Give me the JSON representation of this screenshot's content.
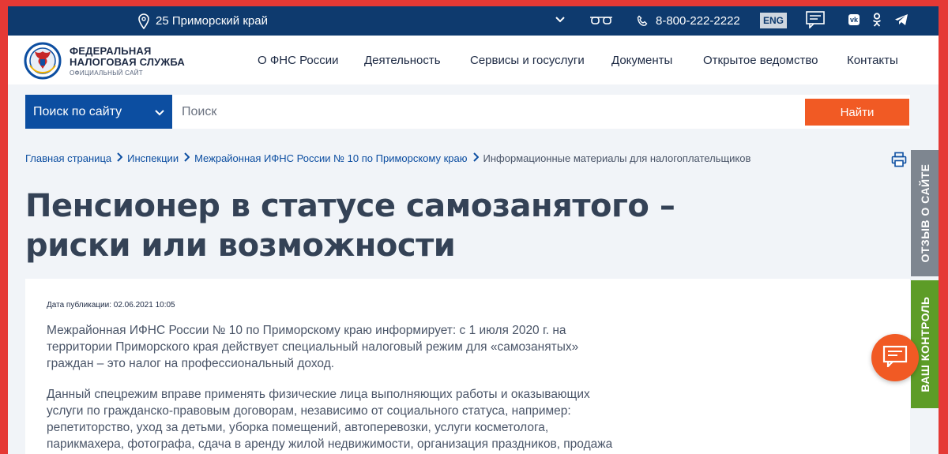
{
  "topbar": {
    "region": "25 Приморский край",
    "phone": "8-800-222-2222",
    "lang": "ENG",
    "vk": "vk"
  },
  "header": {
    "org_line1": "Федеральная",
    "org_line2": "налоговая служба",
    "org_line3": "Официальный сайт",
    "nav": [
      "О ФНС России",
      "Деятельность",
      "Сервисы и госуслуги",
      "Документы",
      "Открытое ведомство",
      "Контакты"
    ]
  },
  "search": {
    "scope": "Поиск по сайту",
    "placeholder": "Поиск",
    "button": "Найти"
  },
  "breadcrumb": [
    "Главная страница",
    "Инспекции",
    "Межрайонная ИФНС России № 10 по Приморскому краю",
    "Информационные материалы для налогоплательщиков"
  ],
  "article": {
    "title": "Пенсионер в статусе самозанятого – риски или возможности",
    "pubdate": "Дата публикации: 02.06.2021 10:05",
    "p1": "Межрайонная ИФНС России № 10 по Приморскому краю информирует: с 1 июля 2020 г. на территории Приморского края действует специальный налоговый режим для «самозанятых» граждан – это налог на профессиональный доход.",
    "p2": "Данный спецрежим вправе применять физические лица выполняющих работы и оказывающих услуги по гражданско-правовым договорам, независимо от социального статуса, например: репетиторство, уход за детьми, уборка помещений, автоперевозки, услуги косметолога, парикмахера, фотографа, сдача в аренду жилой недвижимости, организация праздников, продажа товаров собственного производства."
  },
  "side": {
    "feedback": "ОТЗЫВ О САЙТЕ",
    "control": "ВАШ КОНТРОЛЬ"
  },
  "colors": {
    "topbar": "#0e3a6e",
    "accent": "#f15a24",
    "primary": "#0c4ea1",
    "control_tab": "#5d9c27",
    "feedback_tab": "#7e8690",
    "frame": "#e53935"
  },
  "icons": [
    "location-pin-icon",
    "chevron-down-icon",
    "glasses-icon",
    "phone-icon",
    "chat-icon",
    "vk-icon",
    "odnoklassniki-icon",
    "telegram-icon",
    "print-icon"
  ]
}
